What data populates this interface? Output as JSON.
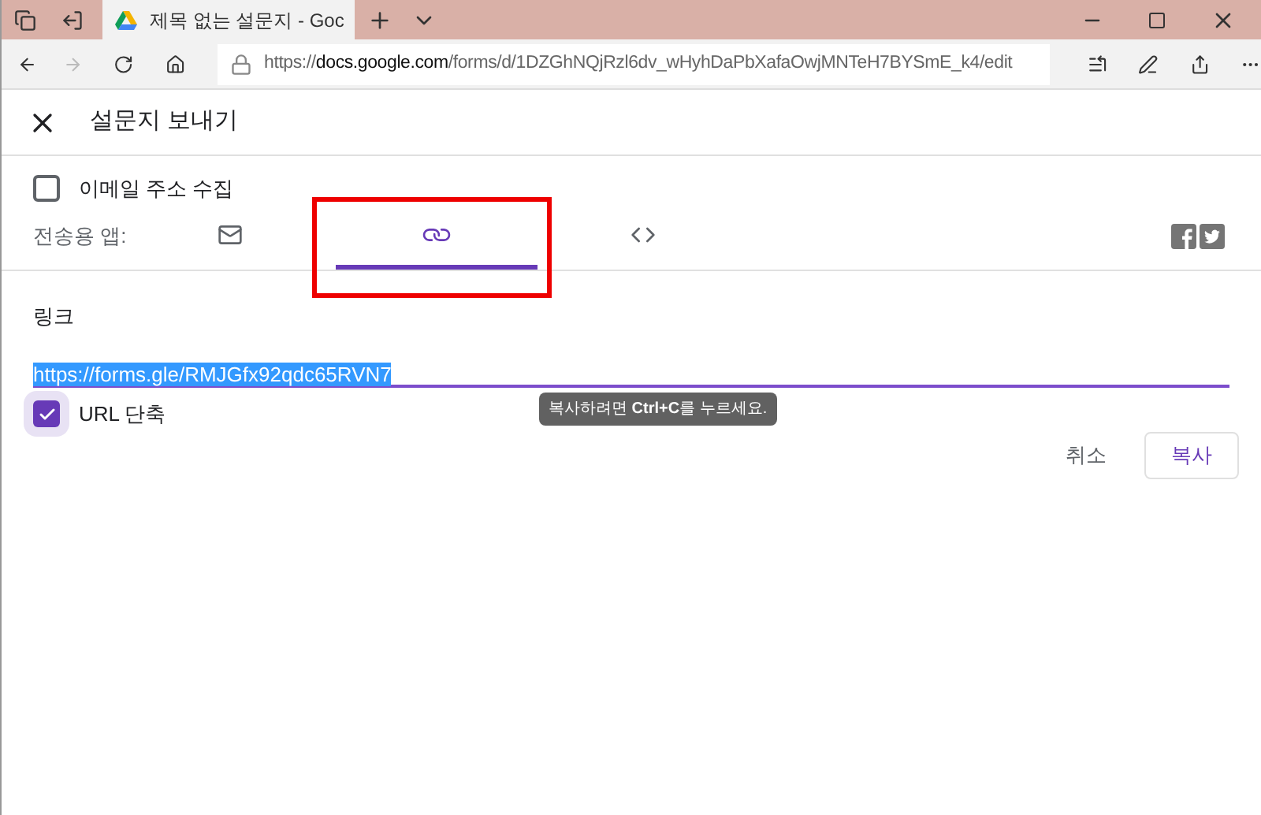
{
  "browser": {
    "tab_title": "제목 없는 설문지 - Goc",
    "url_prefix": "https://",
    "url_host": "docs.google.com",
    "url_path": "/forms/d/1DZGhNQjRzl6dv_wHyhDaPbXafaOwjMNTeH7BYSmE_k4/edit"
  },
  "dialog": {
    "title": "설문지 보내기",
    "collect_email": {
      "label": "이메일 주소 수집",
      "checked": false
    },
    "send_via": {
      "label": "전송용 앱:",
      "tabs": [
        {
          "kind": "email",
          "selected": false
        },
        {
          "kind": "link",
          "selected": true
        },
        {
          "kind": "embed",
          "selected": false
        }
      ]
    },
    "link_label": "링크",
    "link_value": "https://forms.gle/RMJGfx92qdc65RVN7",
    "shorten_url": {
      "label": "URL 단축",
      "checked": true
    },
    "tooltip": "복사하려면 **Ctrl+C**를 누르세요.",
    "buttons": [
      {
        "label": "취소",
        "kind": "text"
      },
      {
        "label": "복사",
        "kind": "outlined"
      }
    ]
  }
}
